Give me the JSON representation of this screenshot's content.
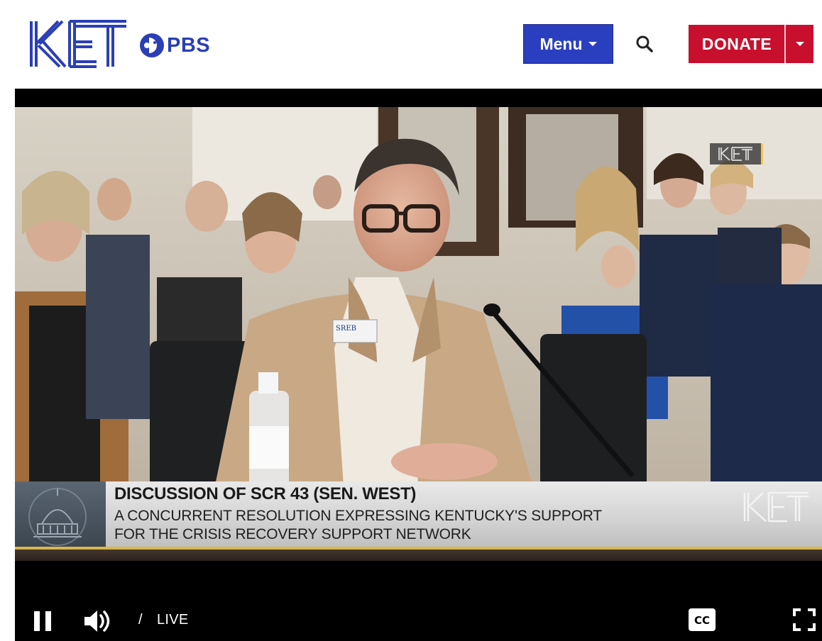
{
  "header": {
    "logo_text": "KET",
    "partner_text": "PBS",
    "menu_label": "Menu",
    "donate_label": "DONATE"
  },
  "video": {
    "watermark_text": "KET",
    "lower_third": {
      "title": "DISCUSSION OF SCR 43 (SEN. WEST)",
      "line1": "A CONCURRENT RESOLUTION EXPRESSING KENTUCKY'S SUPPORT",
      "line2": "FOR THE CRISIS RECOVERY SUPPORT NETWORK",
      "logo_text": "KET"
    },
    "name_badge": "SREB"
  },
  "player": {
    "time_separator": "/",
    "live_label": "LIVE",
    "cc_label": "CC"
  },
  "colors": {
    "brand_blue": "#2a3fb5",
    "donate_red": "#c8102e",
    "accent_gold": "#d8b64a"
  },
  "icons": [
    "pbs-head-icon",
    "search-icon",
    "caret-down-icon",
    "pause-icon",
    "volume-icon",
    "cc-icon",
    "fullscreen-icon",
    "capitol-dome-icon"
  ]
}
